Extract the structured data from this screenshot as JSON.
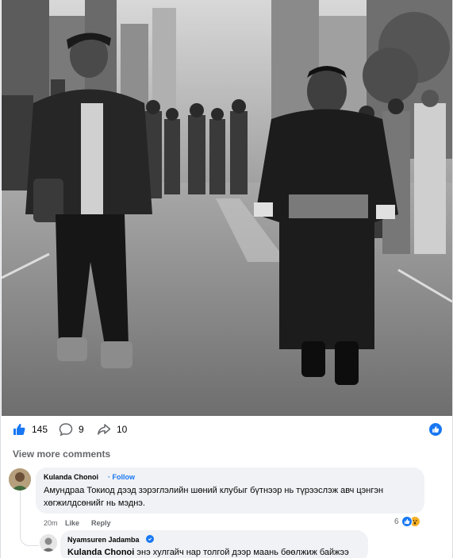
{
  "post": {
    "photo": {
      "alt_icon": "street-procession-photo"
    },
    "stats": {
      "likes": "145",
      "comments": "9",
      "shares": "10"
    }
  },
  "comments_section": {
    "view_more_label": "View more comments",
    "comments": [
      {
        "author": "Kulanda Chonoi",
        "follow_label": "Follow",
        "separator": "·",
        "text": "Амундраа Токиод дээд зэрэглэлийн шөний клубыг бүтнээр нь түрээслэж авч цэнгэн хөгжилдсөнийг нь мэднэ.",
        "time": "20m",
        "like_label": "Like",
        "reply_label": "Reply",
        "reaction_count": "6"
      },
      {
        "author": "Nyamsuren Jadamba",
        "mention": "Kulanda Chonoi",
        "text": " энэ хулгайч нар толгой дээр маань бөөлжиж байжээ"
      }
    ]
  },
  "colors": {
    "accent": "#1877f2",
    "bubble": "#f0f2f5",
    "muted_text": "#65676b",
    "wow": "#f7b125"
  }
}
